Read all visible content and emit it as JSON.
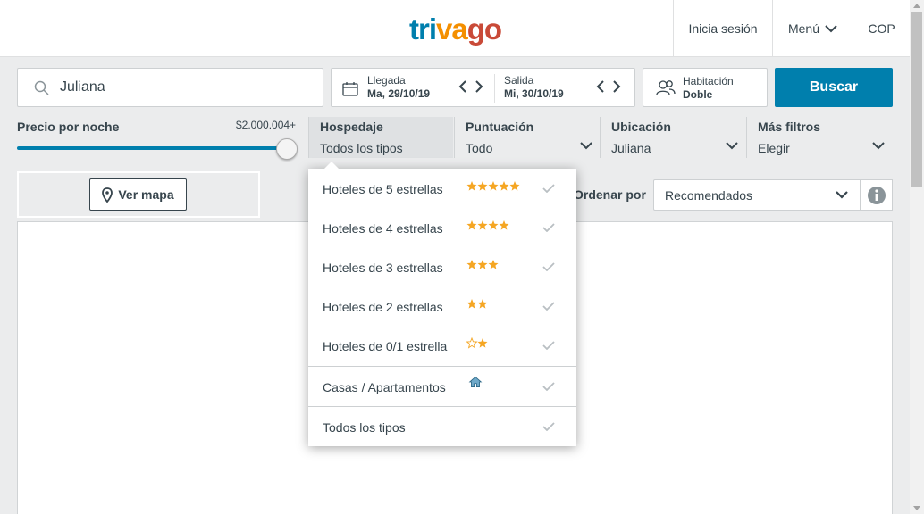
{
  "header": {
    "logo": {
      "part1": "tri",
      "part2": "va",
      "part3": "go"
    },
    "login": "Inicia sesión",
    "menu": "Menú",
    "currency": "COP"
  },
  "search": {
    "destination": "Juliana",
    "checkin_label": "Llegada",
    "checkin_value": "Ma, 29/10/19",
    "checkout_label": "Salida",
    "checkout_value": "Mi, 30/10/19",
    "room_label": "Habitación",
    "room_value": "Doble",
    "button": "Buscar"
  },
  "filters": {
    "price_label": "Precio por noche",
    "price_max": "$2.000.004+",
    "price_slider_level": 1.0,
    "lodging_title": "Hospedaje",
    "lodging_value": "Todos los tipos",
    "rating_title": "Puntuación",
    "rating_value": "Todo",
    "location_title": "Ubicación",
    "location_value": "Juliana",
    "more_title": "Más filtros",
    "more_value": "Elegir"
  },
  "map_button": "Ver mapa",
  "sort": {
    "label": "Ordenar por",
    "value": "Recomendados"
  },
  "lodging_dropdown": {
    "items": [
      {
        "label": "Hoteles de 5 estrellas",
        "stars": 5
      },
      {
        "label": "Hoteles de 4 estrellas",
        "stars": 4
      },
      {
        "label": "Hoteles de 3 estrellas",
        "stars": 3
      },
      {
        "label": "Hoteles de 2 estrellas",
        "stars": 2
      },
      {
        "label": "Hoteles de 0/1 estrella",
        "stars": 1.5
      },
      {
        "label": "Casas / Apartamentos",
        "icon": "house-icon"
      },
      {
        "label": "Todos los tipos"
      }
    ]
  },
  "colors": {
    "brand_blue": "#007fad",
    "star": "#f5a623",
    "text": "#37454d",
    "check": "#b9bfc3"
  }
}
